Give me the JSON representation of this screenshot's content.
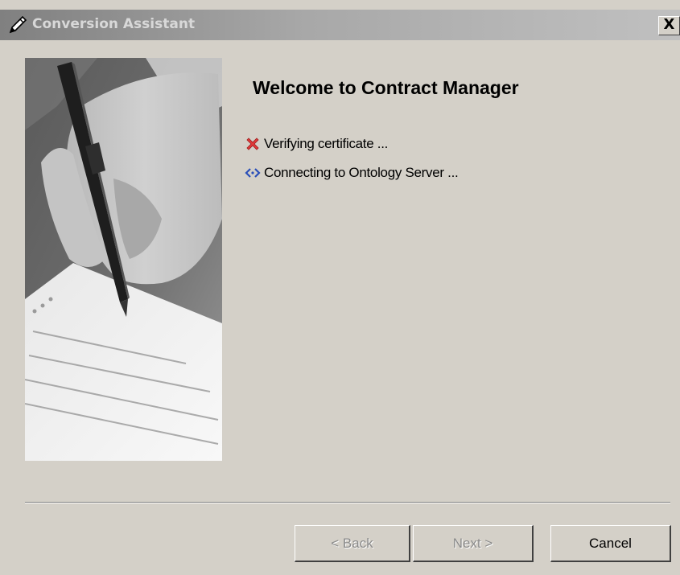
{
  "window": {
    "title": "Conversion Assistant",
    "close_label": "X"
  },
  "content": {
    "heading": "Welcome to Contract Manager",
    "status_items": [
      {
        "icon": "error-x-icon",
        "label": "Verifying certificate ..."
      },
      {
        "icon": "connecting-arrows-icon",
        "label": "Connecting to Ontology Server ..."
      }
    ]
  },
  "buttons": {
    "back_label": "< Back",
    "next_label": "Next >",
    "cancel_label": "Cancel"
  },
  "colors": {
    "dialog_background": "#d4d0c8",
    "error_icon": "#e23a3a",
    "connect_icon": "#2a4fb8"
  }
}
